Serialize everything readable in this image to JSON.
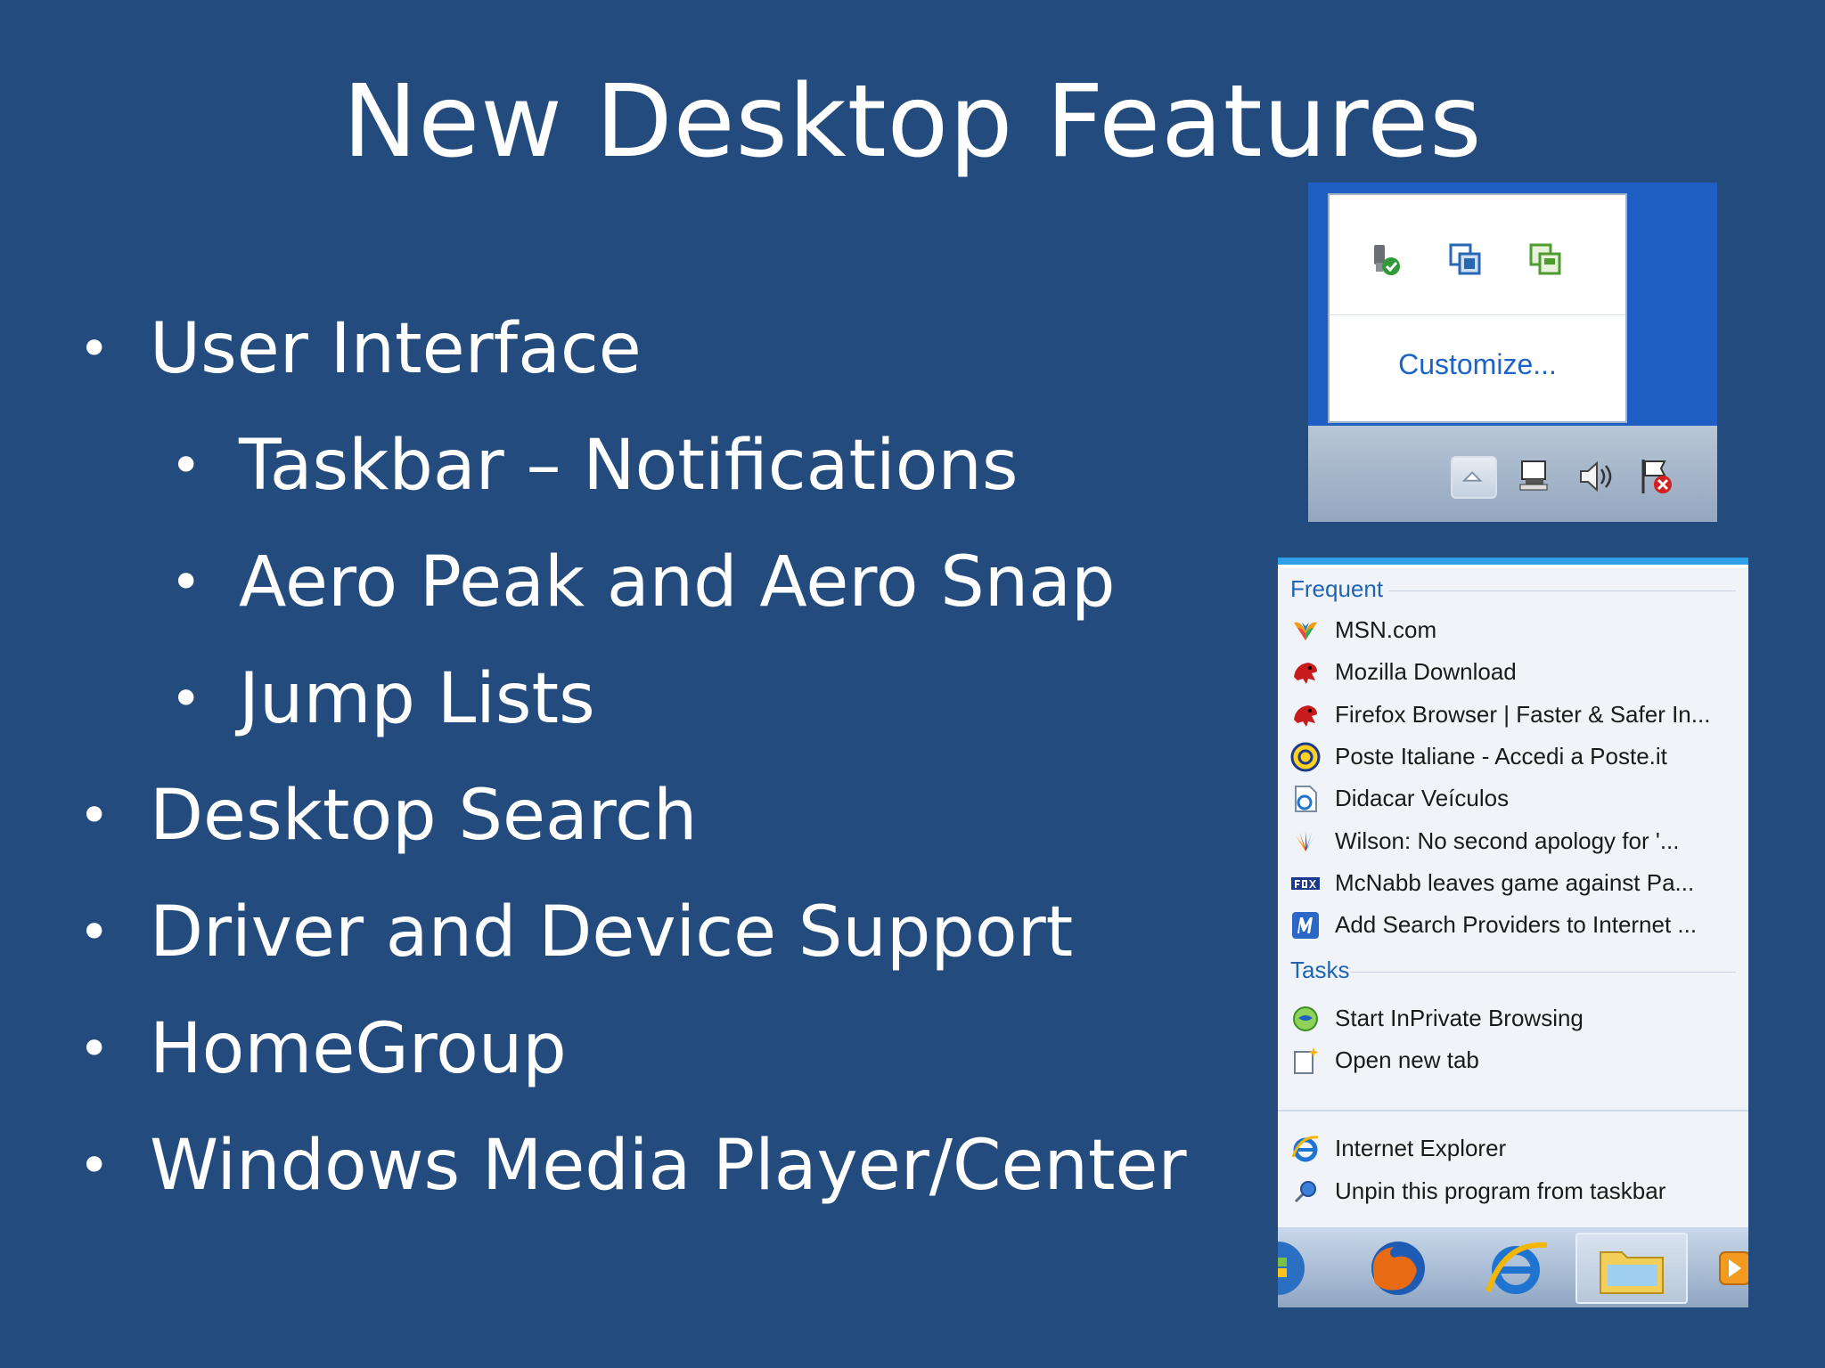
{
  "slide": {
    "title": "New Desktop Features",
    "bullets": [
      {
        "text": "User Interface",
        "level": 1
      },
      {
        "text": "Taskbar – Notifications",
        "level": 2
      },
      {
        "text": "Aero Peak and Aero Snap",
        "level": 2
      },
      {
        "text": "Jump Lists",
        "level": 2
      },
      {
        "text": "Desktop Search",
        "level": 1
      },
      {
        "text": "Driver and Device Support",
        "level": 1
      },
      {
        "text": "HomeGroup",
        "level": 1
      },
      {
        "text": "Windows Media Player/Center",
        "level": 1
      }
    ],
    "bullet_glyph": "•"
  },
  "notifications": {
    "customize_label": "Customize...",
    "hidden_icons": [
      "usb-safe-remove-icon",
      "network-adapter-icon",
      "virtual-machine-icon"
    ],
    "tray_icons": [
      "show-hidden-icons-arrow-icon",
      "network-icon",
      "volume-icon",
      "action-center-flag-icon"
    ]
  },
  "jump_list": {
    "frequent_header": "Frequent",
    "frequent": [
      {
        "label": "MSN.com",
        "icon": "msn-butterfly-icon"
      },
      {
        "label": "Mozilla Download",
        "icon": "mozilla-dinosaur-icon"
      },
      {
        "label": "Firefox Browser | Faster & Safer In...",
        "icon": "mozilla-dinosaur-icon"
      },
      {
        "label": "Poste Italiane - Accedi a Poste.it",
        "icon": "poste-icon"
      },
      {
        "label": "Didacar Veículos",
        "icon": "ie-page-icon"
      },
      {
        "label": "Wilson: No second apology for '...",
        "icon": "nbc-peacock-icon"
      },
      {
        "label": "McNabb leaves game against Pa...",
        "icon": "fox-icon"
      },
      {
        "label": "Add Search Providers to Internet ...",
        "icon": "microsoft-m-icon"
      }
    ],
    "tasks_header": "Tasks",
    "tasks": [
      {
        "label": "Start InPrivate Browsing",
        "icon": "inprivate-icon"
      },
      {
        "label": "Open new tab",
        "icon": "new-tab-icon"
      }
    ],
    "program_items": [
      {
        "label": "Internet Explorer",
        "icon": "internet-explorer-icon"
      },
      {
        "label": "Unpin this program from taskbar",
        "icon": "unpin-icon"
      }
    ],
    "taskbar_buttons": [
      "start-orb-icon",
      "firefox-icon",
      "internet-explorer-icon",
      "explorer-folder-icon",
      "media-player-icon"
    ]
  },
  "colors": {
    "slide_bg": "#244b7d",
    "accent_link": "#1e64c8",
    "jump_header": "#1f63b4"
  }
}
